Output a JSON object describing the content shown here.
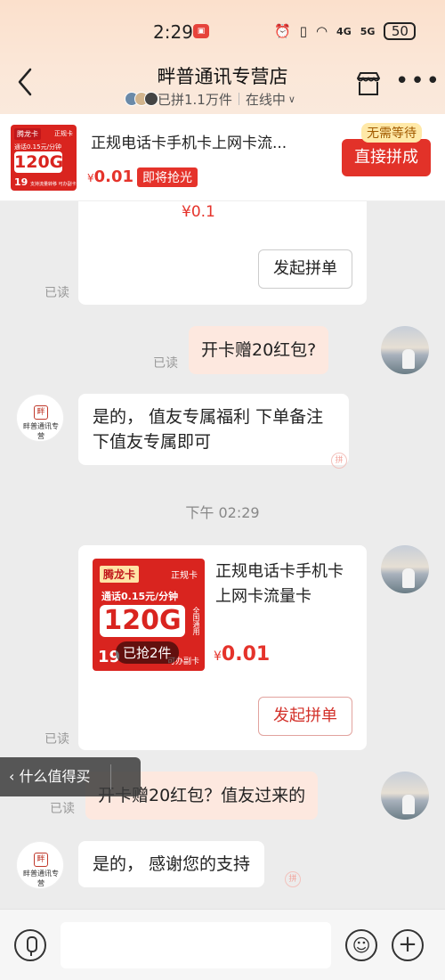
{
  "status_bar": {
    "time": "2:29",
    "signal_1": "4G",
    "signal_2": "5G",
    "battery": "50"
  },
  "header": {
    "shop_name": "畔普通讯专营店",
    "group_count": "已拼1.1万件",
    "online_status": "在线中"
  },
  "banner": {
    "thumb_brand": "腾龙卡",
    "thumb_tag": "正规卡",
    "thumb_rate": "通话0.15元/分钟",
    "thumb_data": "120G",
    "thumb_monthly": "19",
    "thumb_note": "支持流量转移 可办副卡",
    "title": "正规电话卡手机卡上网卡流...",
    "price_symbol": "¥",
    "price": "0.01",
    "tag": "即将抢光",
    "button_tip": "无需等待",
    "button_label": "直接拼成"
  },
  "chat": {
    "first_card_price": "¥0.1",
    "first_card_button": "发起拼单",
    "read_label": "已读",
    "msg_user_1": "开卡赠20红包?",
    "msg_shop_1": "是的，  值友专属福利 下单备注下值友专属即可",
    "time_separator": "下午 02:29",
    "product": {
      "img_brand": "腾龙卡",
      "img_tag": "正规卡",
      "img_rate": "通话0.15元/分钟",
      "img_data": "120G",
      "img_side": "全国通用",
      "img_monthly": "19",
      "img_note": "可办副卡",
      "sold": "已抢2件",
      "title": "正规电话卡手机卡上网卡流量卡",
      "price_symbol": "¥",
      "price": "0.01",
      "button": "发起拼单"
    },
    "msg_user_2": "开卡赠20红包？值友过来的",
    "msg_shop_2": "是的，  感谢您的支持",
    "shop_avatar_text": "畔普通讯专营",
    "corner_mark": "拼"
  },
  "floating": {
    "label": "什么值得买"
  },
  "inputbar": {
    "placeholder": ""
  }
}
